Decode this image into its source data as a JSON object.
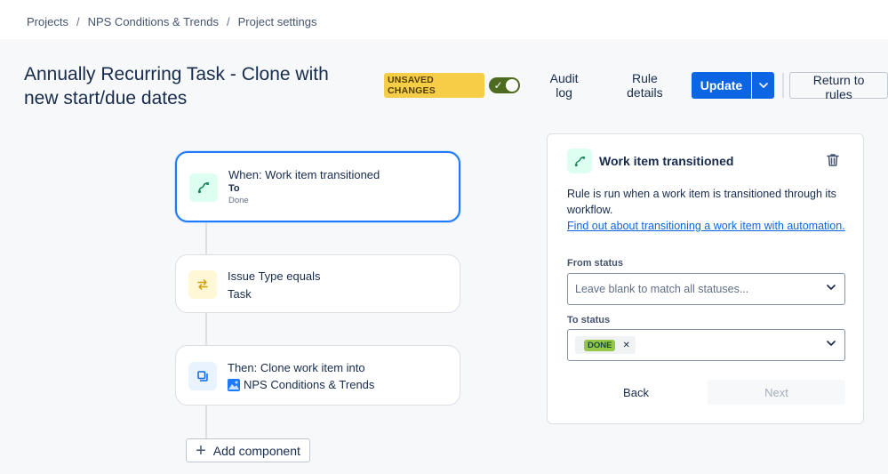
{
  "breadcrumb": {
    "items": [
      "Projects",
      "NPS Conditions & Trends",
      "Project settings"
    ],
    "separator": "/"
  },
  "page_title": "Annually Recurring Task - Clone with new start/due dates",
  "header": {
    "unsaved_label": "UNSAVED CHANGES",
    "toggle_enabled": true,
    "audit_log": "Audit log",
    "rule_details": "Rule details",
    "update": "Update",
    "return_to_rules": "Return to rules"
  },
  "flow": {
    "trigger": {
      "title": "When: Work item transitioned",
      "sub_label": "To",
      "sub_value": "Done",
      "icon": "transition-icon"
    },
    "condition": {
      "title": "Issue Type equals",
      "value": "Task",
      "icon": "swap-arrows-icon"
    },
    "action": {
      "title": "Then: Clone work item into",
      "project": "NPS Conditions & Trends",
      "icon": "clone-icon"
    },
    "add_component": "Add component"
  },
  "panel": {
    "title": "Work item transitioned",
    "description": "Rule is run when a work item is transitioned through its workflow.",
    "help_link": "Find out about transitioning a work item with automation.",
    "from_status_label": "From status",
    "from_status_placeholder": "Leave blank to match all statuses...",
    "to_status_label": "To status",
    "to_status_values": [
      "DONE"
    ],
    "back": "Back",
    "next": "Next"
  },
  "colors": {
    "primary": "#0c66e4",
    "selected_border": "#1d7afc",
    "lozenge": "#f5cd47",
    "toggle_on": "#4c6b1f",
    "done_tag": "#94c748"
  }
}
